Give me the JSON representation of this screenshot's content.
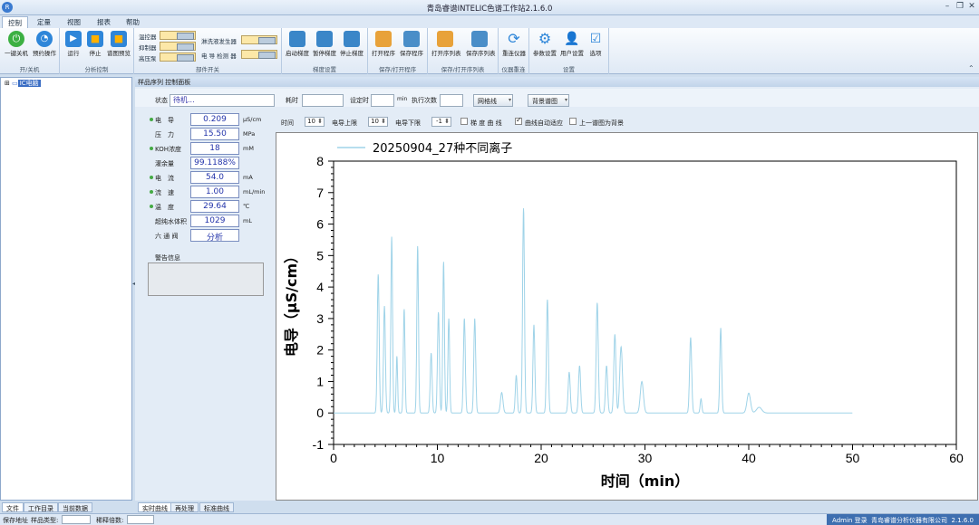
{
  "window": {
    "title": "青岛睿谱INTELIC色谱工作站2.1.6.0"
  },
  "menu_tabs": [
    "控制",
    "定量",
    "视图",
    "报表",
    "帮助"
  ],
  "ribbon": {
    "group1": {
      "label": "开/关机",
      "buttons": [
        "一键关机",
        "预约操作"
      ]
    },
    "group2": {
      "label": "分析控制",
      "buttons": [
        "运行",
        "停止",
        "谱图预览"
      ]
    },
    "group3": {
      "label": "部件开关",
      "switches": [
        "温控器",
        "抑制器",
        "高压泵",
        "淋洗液发生器",
        "电 导 检测 器"
      ]
    },
    "group4": {
      "label": "梯度设置",
      "buttons": [
        "启动梯度",
        "暂停梯度",
        "停止梯度"
      ]
    },
    "group5": {
      "label": "保存/打开程序",
      "buttons": [
        "打开程序",
        "保存程序"
      ]
    },
    "group6": {
      "label": "保存/打开序列表",
      "buttons": [
        "打开序列表",
        "保存序列表"
      ]
    },
    "group7": {
      "label": "仪器重连",
      "buttons": [
        "重连仪器"
      ]
    },
    "group8": {
      "label": "设置",
      "buttons": [
        "参数设置",
        "用户设置",
        "选项"
      ]
    }
  },
  "tree": {
    "root": "IC电脑"
  },
  "left_tabs": [
    "文件",
    "工作目录",
    "当前数据"
  ],
  "panel": {
    "header": "样品序列  控制面板"
  },
  "toolbar": {
    "status_label": "状态",
    "status_value": "待机...",
    "elapsed_label": "耗时",
    "set_time_label": "设定时",
    "min_unit": "min",
    "runs_label": "执行次数",
    "grid_button": "网格线",
    "bg_button": "背景谱图"
  },
  "params": [
    {
      "name": "电　导",
      "value": "0.209",
      "unit": "μS/cm",
      "dot": true
    },
    {
      "name": "压　力",
      "value": "15.50",
      "unit": "MPa",
      "dot": false
    },
    {
      "name": "KOH浓度",
      "value": "18",
      "unit": "mM",
      "dot": true
    },
    {
      "name": "灌余量",
      "value": "99.1188%",
      "unit": "",
      "dot": false
    },
    {
      "name": "电　流",
      "value": "54.0",
      "unit": "mA",
      "dot": true
    },
    {
      "name": "流　速",
      "value": "1.00",
      "unit": "mL/min",
      "dot": true
    },
    {
      "name": "温　度",
      "value": "29.64",
      "unit": "℃",
      "dot": true
    },
    {
      "name": "超纯水体积",
      "value": "1029",
      "unit": "mL",
      "dot": false
    },
    {
      "name": "六 通 阀",
      "value": "分析",
      "unit": "",
      "dot": false
    }
  ],
  "warning_label": "警告信息",
  "chart_controls": {
    "time_label": "时间",
    "time_value": "10",
    "upper_label": "电导上限",
    "upper_value": "10",
    "lower_label": "电导下限",
    "lower_value": "-1",
    "gradient_label": "梯 度 曲 线",
    "gradient_checked": false,
    "auto_label": "曲线自动适应",
    "auto_checked": true,
    "bg_label": "上一谱图为背景",
    "bg_checked": false
  },
  "bottom_tabs": [
    "实时曲线",
    "再处理",
    "标准曲线"
  ],
  "status": {
    "save_path": "保存地址",
    "sample_type": "样品类型:",
    "dilution": "稀释倍数:",
    "user": "Admin 登录",
    "company": "青岛睿谱分析仪器有限公司",
    "version": "2.1.6.0"
  },
  "chart_data": {
    "type": "line",
    "legend": "20250904_27种不同离子",
    "xlabel": "时间（min）",
    "ylabel": "电导（μS/cm）",
    "xlim": [
      0,
      60
    ],
    "ylim": [
      -1,
      8
    ],
    "xticks": [
      0,
      10,
      20,
      30,
      40,
      50,
      60
    ],
    "yticks": [
      -1,
      0,
      1,
      2,
      3,
      4,
      5,
      6,
      7,
      8
    ],
    "line_color": "#9fd3e8",
    "baseline": 0,
    "x_end": 50,
    "peaks": [
      [
        4.3,
        4.4,
        0.09
      ],
      [
        4.9,
        3.4,
        0.09
      ],
      [
        5.6,
        5.6,
        0.08
      ],
      [
        6.1,
        1.8,
        0.07
      ],
      [
        6.8,
        3.3,
        0.08
      ],
      [
        8.1,
        5.3,
        0.08
      ],
      [
        9.4,
        1.9,
        0.09
      ],
      [
        10.1,
        3.2,
        0.09
      ],
      [
        10.6,
        4.8,
        0.08
      ],
      [
        11.1,
        3.0,
        0.08
      ],
      [
        12.6,
        3.0,
        0.09
      ],
      [
        13.6,
        3.0,
        0.09
      ],
      [
        16.2,
        0.65,
        0.12
      ],
      [
        17.6,
        1.2,
        0.09
      ],
      [
        18.3,
        6.5,
        0.09
      ],
      [
        19.3,
        2.8,
        0.09
      ],
      [
        20.6,
        3.6,
        0.09
      ],
      [
        22.7,
        1.3,
        0.1
      ],
      [
        23.7,
        1.5,
        0.1
      ],
      [
        25.4,
        3.5,
        0.1
      ],
      [
        26.3,
        1.5,
        0.1
      ],
      [
        27.1,
        2.5,
        0.1
      ],
      [
        27.7,
        2.1,
        0.13
      ],
      [
        29.7,
        1.0,
        0.15
      ],
      [
        34.4,
        2.4,
        0.1
      ],
      [
        35.4,
        0.45,
        0.08
      ],
      [
        37.3,
        2.7,
        0.09
      ],
      [
        40.0,
        0.63,
        0.17
      ],
      [
        41.0,
        0.18,
        0.25
      ]
    ]
  }
}
